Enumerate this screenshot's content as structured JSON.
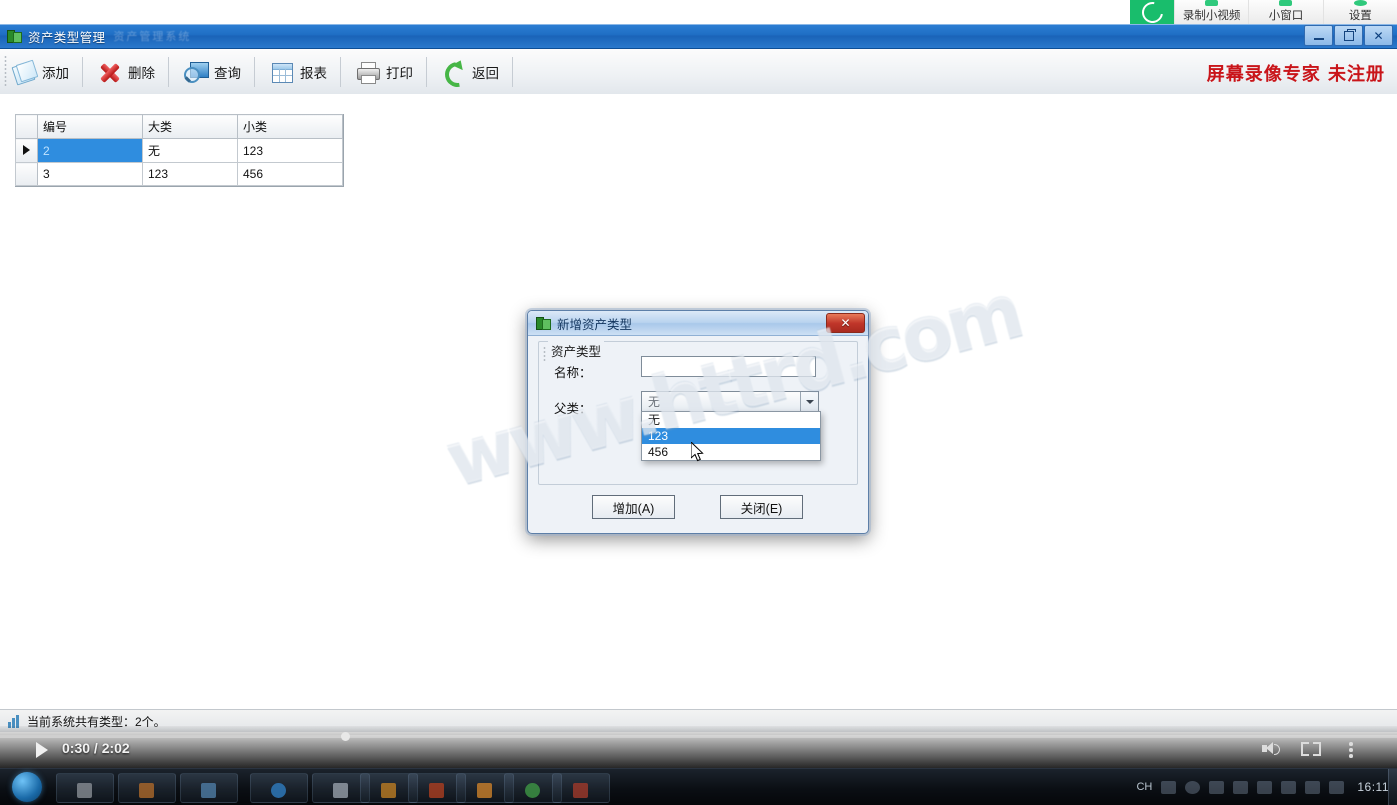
{
  "recorder_bar": {
    "logo_icon": "e-logo-icon",
    "items": [
      {
        "label": "录制小视频",
        "icon": "record-video-icon"
      },
      {
        "label": "小窗口",
        "icon": "small-window-icon"
      },
      {
        "label": "设置",
        "icon": "gear-icon"
      }
    ]
  },
  "window": {
    "title": "资产类型管理",
    "ghost_title": "资产管理系统",
    "buttons": {
      "minimize": "–",
      "restore": "❐",
      "close": "✕"
    }
  },
  "toolbar": {
    "buttons": [
      {
        "label": "添加",
        "icon": "add-page-icon"
      },
      {
        "label": "删除",
        "icon": "red-x-icon"
      },
      {
        "label": "查询",
        "icon": "search-monitor-icon"
      },
      {
        "label": "报表",
        "icon": "table-grid-icon"
      },
      {
        "label": "打印",
        "icon": "printer-icon"
      },
      {
        "label": "返回",
        "icon": "green-back-arrow-icon"
      }
    ],
    "brand": "屏幕录像专家 未注册",
    "brand_color": "#c9151a"
  },
  "grid": {
    "columns": [
      "编号",
      "大类",
      "小类"
    ],
    "rows": [
      {
        "selected": true,
        "cells": [
          "2",
          "无",
          "123"
        ]
      },
      {
        "selected": false,
        "cells": [
          "3",
          "123",
          "456"
        ]
      }
    ]
  },
  "statusbar": {
    "text": "当前系统共有类型：2个。",
    "icon": "chart-icon"
  },
  "dialog": {
    "title": "新增资产类型",
    "title_icon": "app-icon",
    "close_label": "✕",
    "group_label": "资产类型",
    "fields": [
      {
        "label": "名称：",
        "value": "",
        "placeholder": ""
      },
      {
        "label": "父类：",
        "value": "无"
      }
    ],
    "dropdown": {
      "open": true,
      "options": [
        "无",
        "123",
        "456"
      ],
      "highlighted_index": 1
    },
    "buttons": [
      {
        "label": "增加(A)"
      },
      {
        "label": "关闭(E)"
      }
    ]
  },
  "watermark": {
    "text": "www.httrd.com"
  },
  "player": {
    "current_time": "0:30",
    "total_time": "2:02",
    "timecode": "0:30 / 2:02",
    "progress_percent": 24.4,
    "controls": [
      {
        "name": "play-button",
        "icon": "play-icon"
      },
      {
        "name": "volume-button",
        "icon": "volume-icon"
      },
      {
        "name": "fullscreen-button",
        "icon": "fullscreen-icon"
      },
      {
        "name": "more-button",
        "icon": "kebab-menu-icon"
      }
    ]
  },
  "taskbar": {
    "start_icon": "windows-start-orb-icon",
    "input_indicator": "CH",
    "clock": "16:11",
    "tray_icons": [
      "keyboard-icon",
      "help-icon",
      "network-icon",
      "arrow-up-icon",
      "monitor-icon",
      "shield-icon",
      "shield-icon",
      "shield-icon"
    ]
  }
}
